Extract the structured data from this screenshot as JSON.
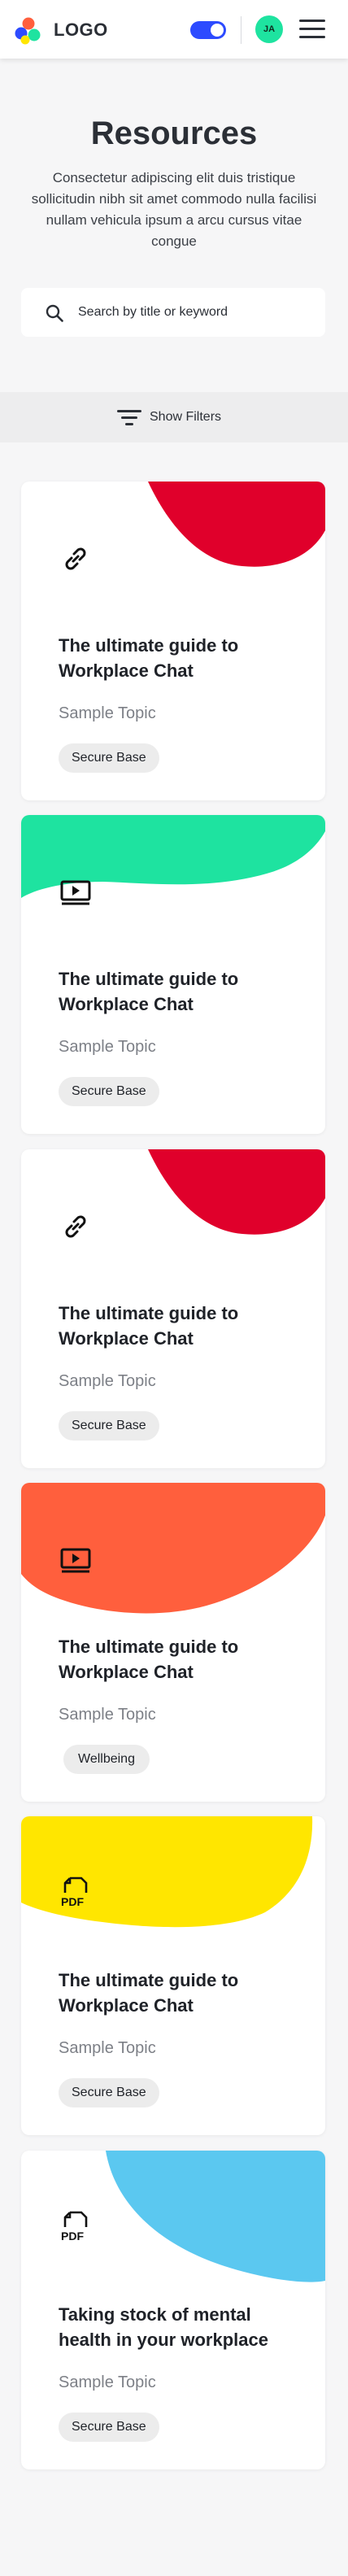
{
  "header": {
    "logo_text": "LOGO",
    "avatar_initials": "JA",
    "toggle_state": "on",
    "toggle_color": "#2d4bff",
    "avatar_color": "#1ee3a0"
  },
  "hero": {
    "title": "Resources",
    "description": "Consectetur adipiscing elit duis tristique sollicitudin nibh sit amet commodo nulla facilisi nullam vehicula ipsum a arcu cursus vitae congue",
    "search_placeholder": "Search by title or keyword"
  },
  "filters": {
    "label": "Show Filters"
  },
  "cards": [
    {
      "icon": "link-icon",
      "accent": "#e0002b",
      "title": "The ultimate guide to Workplace Chat",
      "topic": "Sample Topic",
      "tag": "Secure Base"
    },
    {
      "icon": "video-icon",
      "accent": "#1ee3a0",
      "title": "The ultimate guide to Workplace Chat",
      "topic": "Sample Topic",
      "tag": "Secure Base"
    },
    {
      "icon": "link-icon",
      "accent": "#e0002b",
      "title": "The ultimate guide to Workplace Chat",
      "topic": "Sample Topic",
      "tag": "Secure Base"
    },
    {
      "icon": "video-icon",
      "accent": "#ff5f3d",
      "title": "The ultimate guide to Workplace Chat",
      "topic": "Sample Topic",
      "tag": "Wellbeing"
    },
    {
      "icon": "pdf-icon",
      "accent": "#ffe600",
      "title": "The ultimate guide to Workplace Chat",
      "topic": "Sample Topic",
      "tag": "Secure Base"
    },
    {
      "icon": "pdf-icon",
      "accent": "#5bc8f0",
      "title": "Taking stock of mental health in your workplace",
      "topic": "Sample Topic",
      "tag": "Secure Base"
    }
  ]
}
